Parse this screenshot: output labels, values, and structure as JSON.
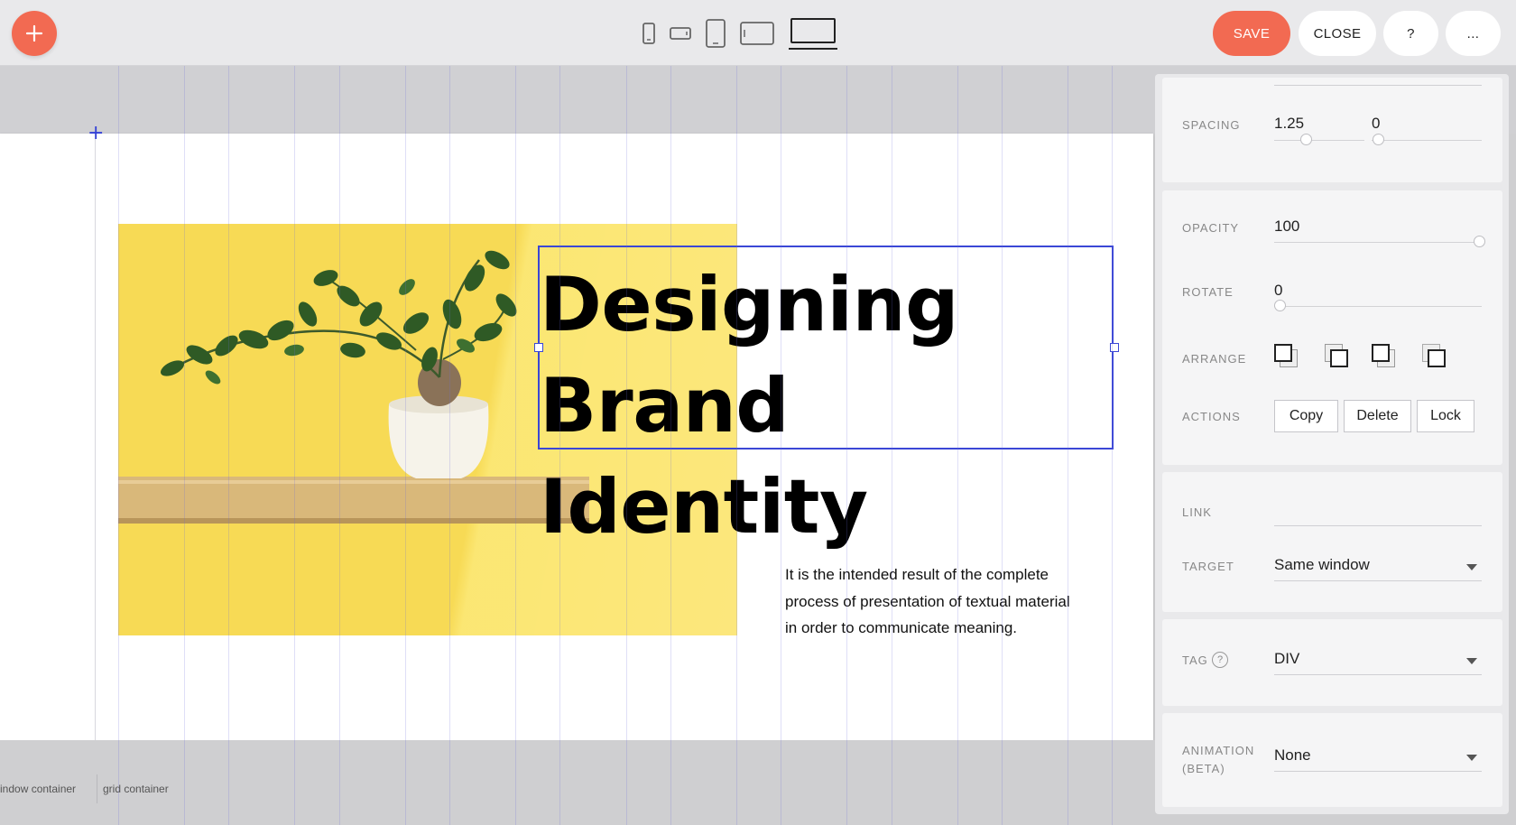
{
  "toolbar": {
    "save_label": "SAVE",
    "close_label": "CLOSE",
    "help_label": "?",
    "more_label": "...",
    "colors": {
      "accent": "#f26a52",
      "selection": "#3b47d6"
    }
  },
  "canvas": {
    "headline_line1": "Designing",
    "headline_line2": "Brand Identity",
    "body_text": "It is the intended result of the complete process of presentation of textual material in order to communicate meaning.",
    "hero_background": "#f7da55"
  },
  "footer": {
    "crumb_window": "indow container",
    "crumb_grid": "grid container"
  },
  "inspector": {
    "spacing": {
      "label": "SPACING",
      "value1": "1.25",
      "value2": "0"
    },
    "opacity": {
      "label": "OPACITY",
      "value": "100"
    },
    "rotate": {
      "label": "ROTATE",
      "value": "0"
    },
    "arrange": {
      "label": "ARRANGE"
    },
    "actions": {
      "label": "ACTIONS",
      "copy": "Copy",
      "delete": "Delete",
      "lock": "Lock"
    },
    "link": {
      "label": "LINK",
      "value": ""
    },
    "target": {
      "label": "TARGET",
      "value": "Same window"
    },
    "tag": {
      "label": "TAG",
      "help": "?",
      "value": "DIV"
    },
    "animation": {
      "label_line1": "ANIMATION",
      "label_line2": "(BETA)",
      "value": "None"
    }
  }
}
